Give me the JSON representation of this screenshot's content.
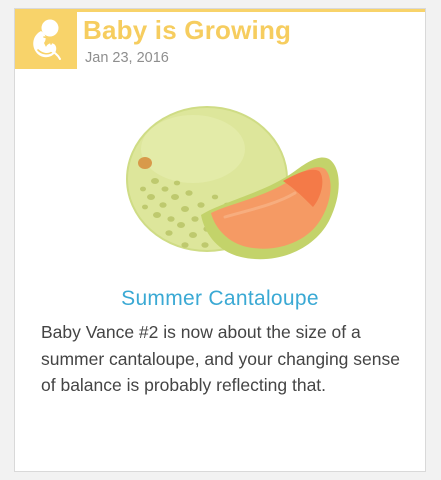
{
  "card": {
    "title": "Baby is Growing",
    "date": "Jan 23, 2016",
    "badge_icon": "fetus-icon",
    "illustration_icon": "cantaloupe-icon",
    "item_name": "Summer Cantaloupe",
    "description": "Baby Vance #2 is now about the size of a summer cantaloupe, and your changing sense of balance is probably reflecting that."
  },
  "colors": {
    "accent_yellow": "#f8d36a",
    "title_yellow": "#f6cd5f",
    "item_blue": "#3aa9d4",
    "body_text": "#444444",
    "date_gray": "#8e8e8e"
  }
}
